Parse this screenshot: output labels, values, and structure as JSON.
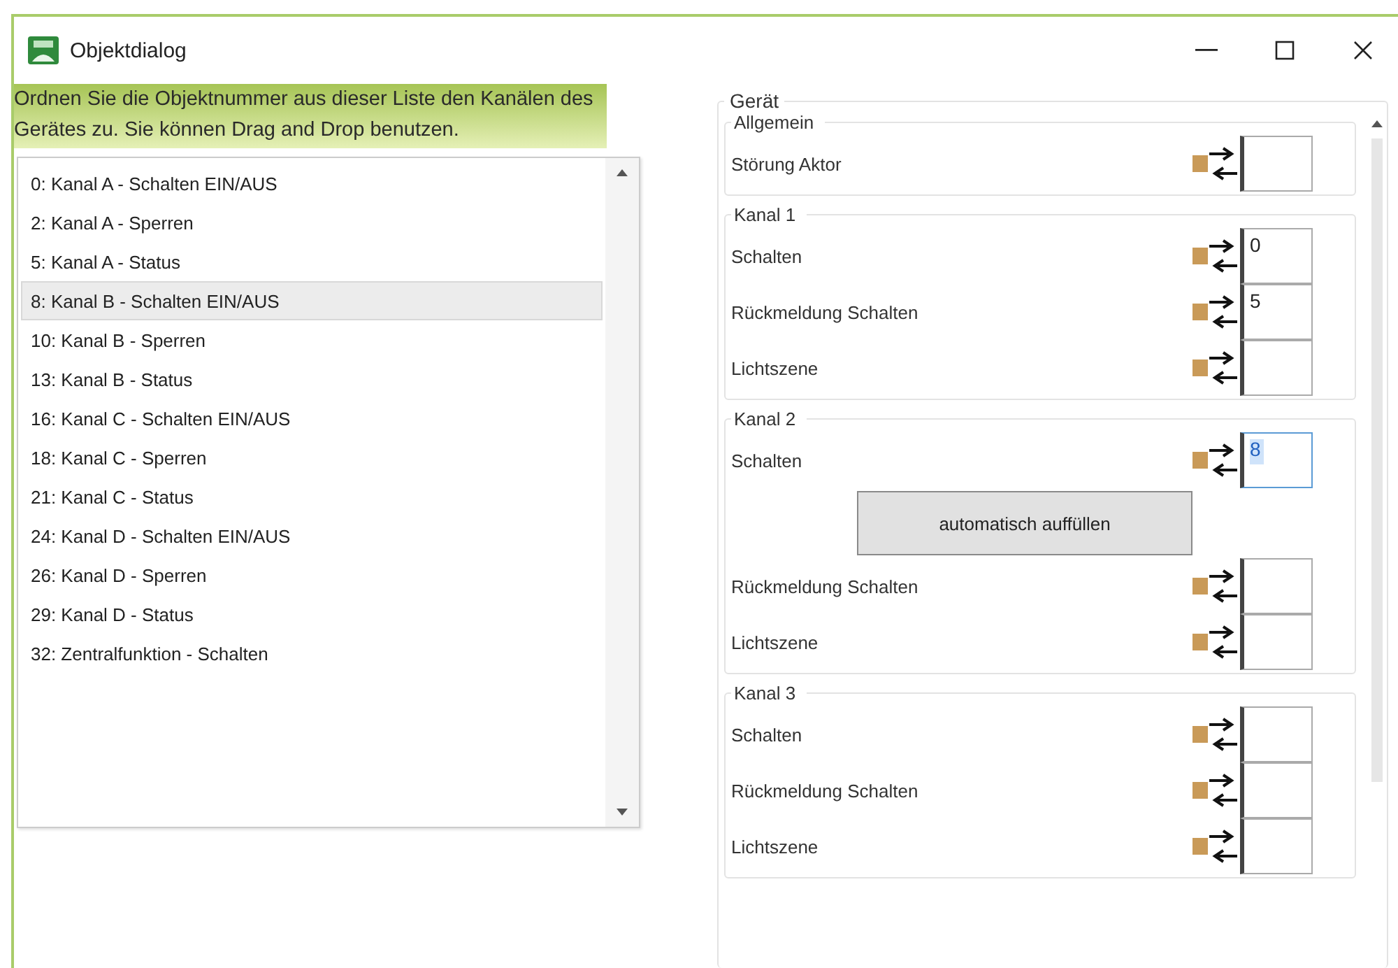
{
  "window": {
    "title": "Objektdialog"
  },
  "hint": "Ordnen Sie die Objektnummer aus dieser Liste den Kanälen des Gerätes zu. Sie können Drag and Drop benutzen.",
  "objects": [
    {
      "label": "0: Kanal A - Schalten EIN/AUS",
      "selected": false
    },
    {
      "label": "2: Kanal A - Sperren",
      "selected": false
    },
    {
      "label": "5: Kanal A - Status",
      "selected": false
    },
    {
      "label": "8: Kanal B - Schalten EIN/AUS",
      "selected": true
    },
    {
      "label": "10: Kanal B - Sperren",
      "selected": false
    },
    {
      "label": "13: Kanal B - Status",
      "selected": false
    },
    {
      "label": "16: Kanal C - Schalten EIN/AUS",
      "selected": false
    },
    {
      "label": "18: Kanal C - Sperren",
      "selected": false
    },
    {
      "label": "21: Kanal C - Status",
      "selected": false
    },
    {
      "label": "24: Kanal D - Schalten EIN/AUS",
      "selected": false
    },
    {
      "label": "26: Kanal D - Sperren",
      "selected": false
    },
    {
      "label": "29: Kanal D - Status",
      "selected": false
    },
    {
      "label": "32: Zentralfunktion - Schalten",
      "selected": false
    }
  ],
  "device": {
    "title": "Gerät",
    "groups": [
      {
        "title": "Allgemein",
        "items": [
          {
            "kind": "row",
            "label": "Störung Aktor",
            "focused": false
          }
        ]
      },
      {
        "title": "Kanal 1",
        "items": [
          {
            "kind": "row",
            "label": "Schalten",
            "value": "0",
            "focused": false
          },
          {
            "kind": "row",
            "label": "Rückmeldung Schalten",
            "value": "5",
            "focused": false
          },
          {
            "kind": "row",
            "label": "Lichtszene",
            "focused": false
          }
        ]
      },
      {
        "title": "Kanal 2",
        "items": [
          {
            "kind": "row",
            "label": "Schalten",
            "value": "8",
            "focused": true
          },
          {
            "kind": "button",
            "label": "automatisch auffüllen"
          },
          {
            "kind": "row",
            "label": "Rückmeldung Schalten",
            "focused": false
          },
          {
            "kind": "row",
            "label": "Lichtszene",
            "focused": false
          }
        ]
      },
      {
        "title": "Kanal 3",
        "items": [
          {
            "kind": "row",
            "label": "Schalten",
            "focused": false
          },
          {
            "kind": "row",
            "label": "Rückmeldung Schalten",
            "focused": false
          },
          {
            "kind": "row",
            "label": "Lichtszene",
            "focused": false
          }
        ]
      }
    ]
  }
}
